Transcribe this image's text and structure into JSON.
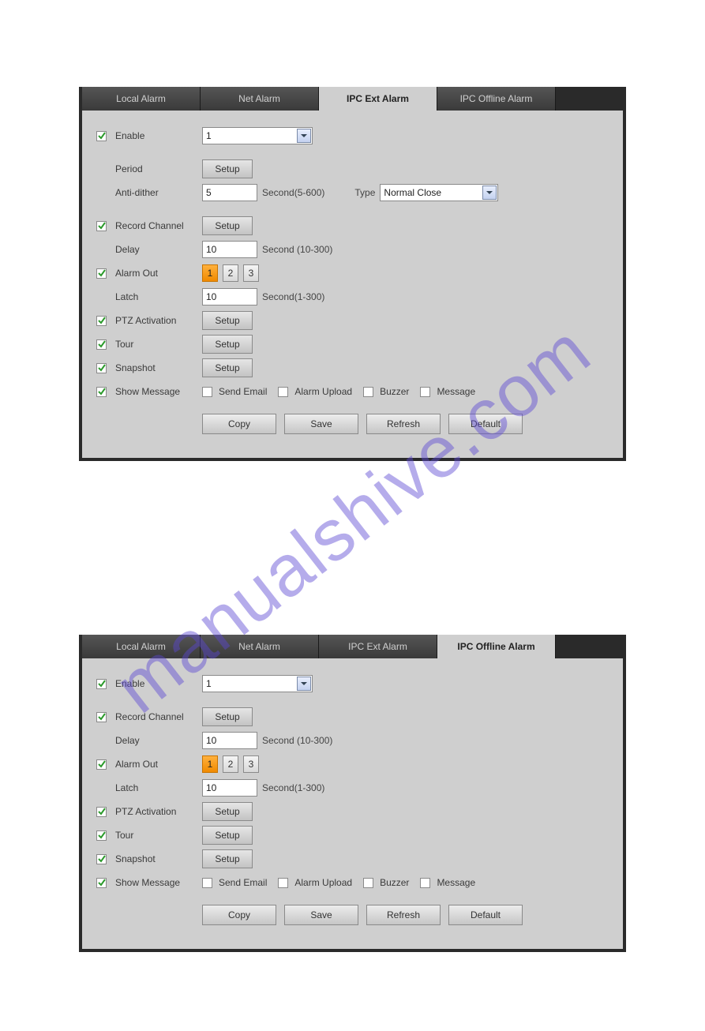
{
  "watermark": "manualshive.com",
  "panel_a": {
    "tabs": [
      "Local Alarm",
      "Net Alarm",
      "IPC Ext Alarm",
      "IPC Offline Alarm"
    ],
    "active_tab": 2,
    "enable_label": "Enable",
    "channel_value": "1",
    "period_label": "Period",
    "period_btn": "Setup",
    "anti_dither_label": "Anti-dither",
    "anti_dither_value": "5",
    "anti_dither_suffix": "Second(5-600)",
    "type_label": "Type",
    "type_value": "Normal Close",
    "record_channel_label": "Record Channel",
    "record_channel_btn": "Setup",
    "delay_label": "Delay",
    "delay_value": "10",
    "delay_suffix": "Second (10-300)",
    "alarm_out_label": "Alarm Out",
    "alarm_out_values": [
      "1",
      "2",
      "3"
    ],
    "latch_label": "Latch",
    "latch_value": "10",
    "latch_suffix": "Second(1-300)",
    "ptz_label": "PTZ Activation",
    "ptz_btn": "Setup",
    "tour_label": "Tour",
    "tour_btn": "Setup",
    "snapshot_label": "Snapshot",
    "snapshot_btn": "Setup",
    "show_message_label": "Show Message",
    "send_email_label": "Send Email",
    "alarm_upload_label": "Alarm Upload",
    "buzzer_label": "Buzzer",
    "message_label": "Message",
    "copy_btn": "Copy",
    "save_btn": "Save",
    "refresh_btn": "Refresh",
    "default_btn": "Default"
  },
  "panel_b": {
    "tabs": [
      "Local Alarm",
      "Net Alarm",
      "IPC Ext Alarm",
      "IPC Offline Alarm"
    ],
    "active_tab": 3,
    "enable_label": "Enable",
    "channel_value": "1",
    "record_channel_label": "Record Channel",
    "record_channel_btn": "Setup",
    "delay_label": "Delay",
    "delay_value": "10",
    "delay_suffix": "Second (10-300)",
    "alarm_out_label": "Alarm Out",
    "alarm_out_values": [
      "1",
      "2",
      "3"
    ],
    "latch_label": "Latch",
    "latch_value": "10",
    "latch_suffix": "Second(1-300)",
    "ptz_label": "PTZ Activation",
    "ptz_btn": "Setup",
    "tour_label": "Tour",
    "tour_btn": "Setup",
    "snapshot_label": "Snapshot",
    "snapshot_btn": "Setup",
    "show_message_label": "Show Message",
    "send_email_label": "Send Email",
    "alarm_upload_label": "Alarm Upload",
    "buzzer_label": "Buzzer",
    "message_label": "Message",
    "copy_btn": "Copy",
    "save_btn": "Save",
    "refresh_btn": "Refresh",
    "default_btn": "Default"
  }
}
